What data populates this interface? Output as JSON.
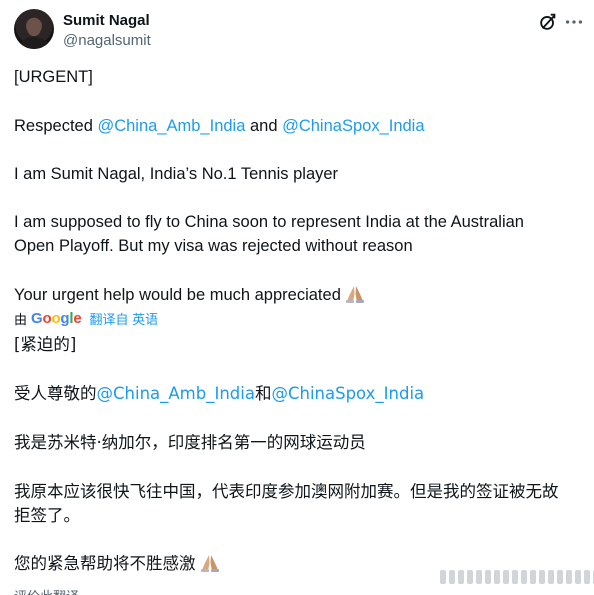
{
  "author": {
    "display_name": "Sumit Nagal",
    "handle": "@nagalsumit"
  },
  "icons": {
    "grok": "grok-icon",
    "more": "more-options-icon",
    "emoji": "folded-hands-emoji"
  },
  "colors": {
    "mention": "#1d9bf0",
    "text": "#0f1419",
    "secondary": "#536471"
  },
  "original": {
    "line1": "[URGENT]",
    "line2_prefix": "Respected ",
    "mention1": "@China_Amb_India",
    "line2_and": " and ",
    "mention2": "@ChinaSpox_India",
    "line3": "I am Sumit Nagal, India’s No.1 Tennis player",
    "line4a": "I am supposed to fly to China soon to represent India at the Australian",
    "line4b": "Open Playoff. But my visa was rejected without reason",
    "line5": "Your urgent help would be much appreciated"
  },
  "translate_bar": {
    "by": "由",
    "google": [
      "G",
      "o",
      "o",
      "g",
      "l",
      "e"
    ],
    "link": "翻译自 英语"
  },
  "translated": {
    "line1": "[紧迫的]",
    "line2_prefix": "受人尊敬的",
    "mention1": "@China_Amb_India",
    "line2_and": "和",
    "mention2": "@ChinaSpox_India",
    "line3": "我是苏米特·纳加尔，印度排名第一的网球运动员",
    "line4a": "我原本应该很快飞往中国，代表印度参加澳网附加赛。但是我的签证被无故",
    "line4b": "拒签了。",
    "line5": "您的紧急帮助将不胜感激"
  },
  "bottom_partial": "评价此翻译"
}
